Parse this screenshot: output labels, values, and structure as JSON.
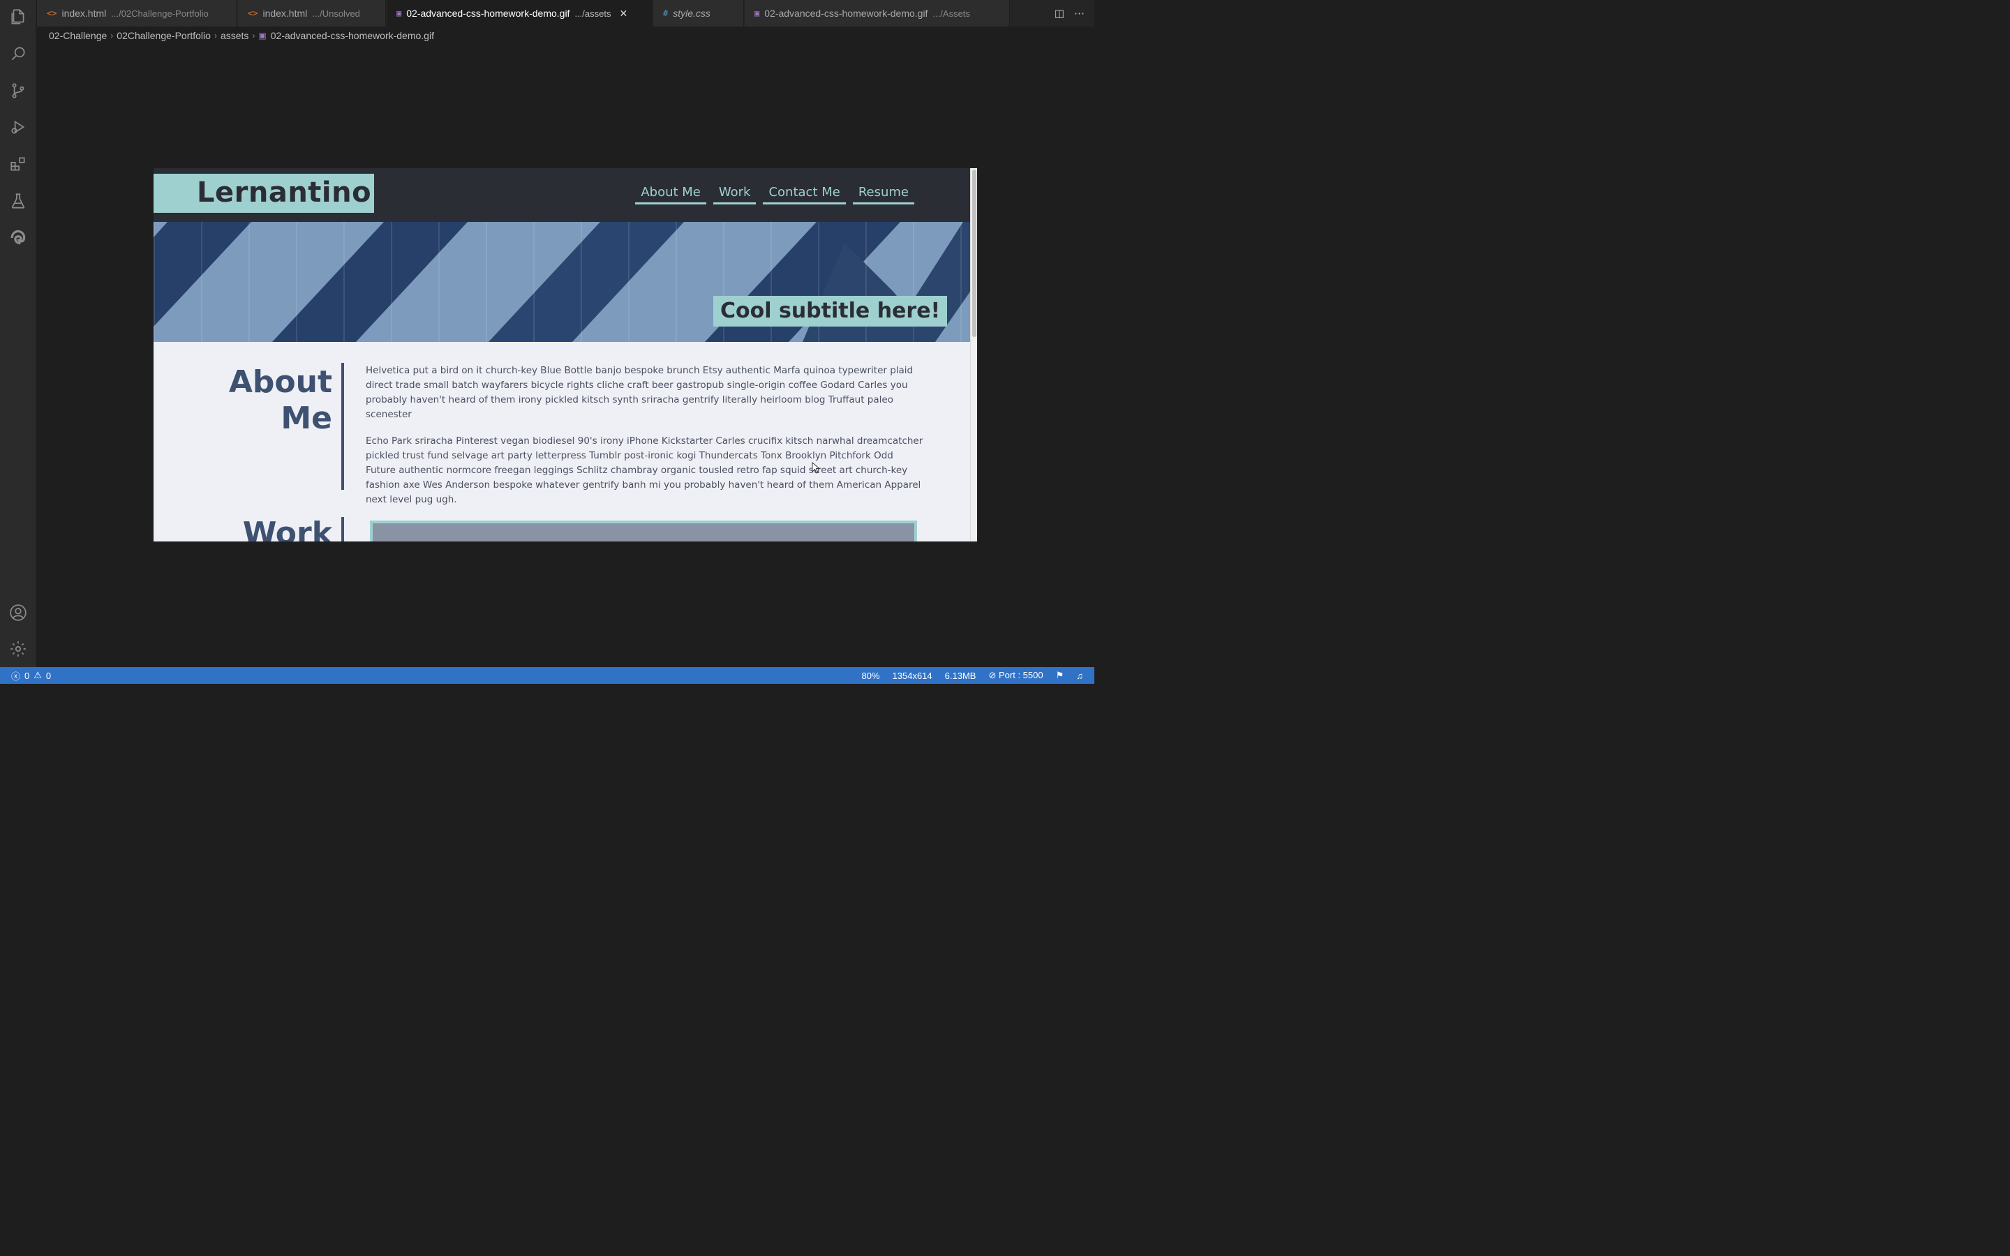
{
  "editor": {
    "tabs": [
      {
        "name": "index.html",
        "path": ".../02Challenge-Portfolio",
        "icon": "html-file-icon"
      },
      {
        "name": "index.html",
        "path": ".../Unsolved",
        "icon": "html-file-icon"
      },
      {
        "name": "02-advanced-css-homework-demo.gif",
        "path": ".../assets",
        "icon": "image-file-icon",
        "active": true
      },
      {
        "name": "style.css",
        "path": "",
        "icon": "css-file-icon",
        "italic": true
      },
      {
        "name": "02-advanced-css-homework-demo.gif",
        "path": ".../Assets",
        "icon": "image-file-icon"
      }
    ],
    "breadcrumb": [
      "02-Challenge",
      "02Challenge-Portfolio",
      "assets",
      "02-advanced-css-homework-demo.gif"
    ]
  },
  "preview_site": {
    "logo": "Lernantino",
    "nav": [
      "About Me",
      "Work",
      "Contact Me",
      "Resume"
    ],
    "hero_subtitle": "Cool subtitle here!",
    "about_title_line1": "About",
    "about_title_line2": "Me",
    "about_paragraphs": [
      "Helvetica put a bird on it church-key Blue Bottle banjo bespoke brunch Etsy authentic Marfa quinoa typewriter plaid direct trade small batch wayfarers bicycle rights cliche craft beer gastropub single-origin coffee Godard Carles you probably haven't heard of them irony pickled kitsch synth sriracha gentrify literally heirloom blog Truffaut paleo scenester",
      "Echo Park sriracha Pinterest vegan biodiesel 90's irony iPhone Kickstarter Carles crucifix kitsch narwhal dreamcatcher pickled trust fund selvage art party letterpress Tumblr post-ironic kogi Thundercats Tonx Brooklyn Pitchfork Odd Future authentic normcore freegan leggings Schlitz chambray organic tousled retro fap squid street art church-key fashion axe Wes Anderson bespoke whatever gentrify banh mi you probably haven't heard of them American Apparel next level pug ugh."
    ],
    "work_title": "Work"
  },
  "statusbar": {
    "errors": "0",
    "warnings": "0",
    "zoom": "80%",
    "dimensions": "1354x614",
    "filesize": "6.13MB",
    "port": "Port : 5500"
  },
  "colors": {
    "accent": "#9fd0d0",
    "header_bg": "#2b2d35",
    "heading": "#3e5170",
    "statusbar": "#3072c6"
  }
}
